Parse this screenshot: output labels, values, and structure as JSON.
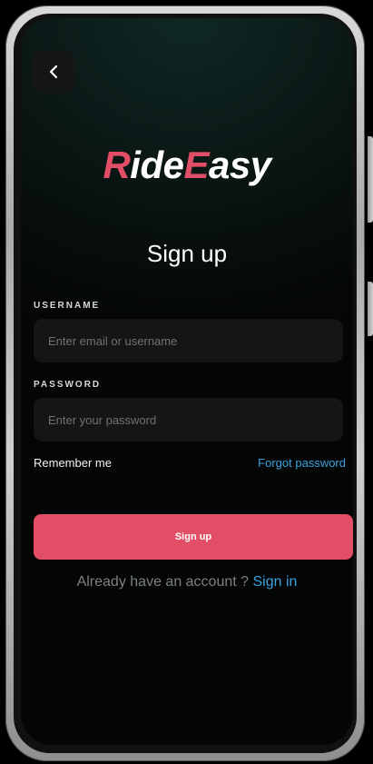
{
  "brand": {
    "part1_accent": "R",
    "part1_rest": "ide",
    "part2_accent": "E",
    "part2_rest": "asy"
  },
  "page": {
    "title": "Sign up"
  },
  "form": {
    "username_label": "USERNAME",
    "username_placeholder": "Enter email or username",
    "password_label": "PASSWORD",
    "password_placeholder": "Enter your password",
    "remember_label": "Remember me",
    "forgot_label": "Forgot password",
    "submit_label": "Sign up"
  },
  "footer": {
    "prompt": "Already have an account ? ",
    "link": "Sign in"
  },
  "colors": {
    "accent": "#e24e66",
    "link": "#3aa3e0",
    "background": "#050707"
  },
  "icons": {
    "back": "chevron-left-icon"
  }
}
